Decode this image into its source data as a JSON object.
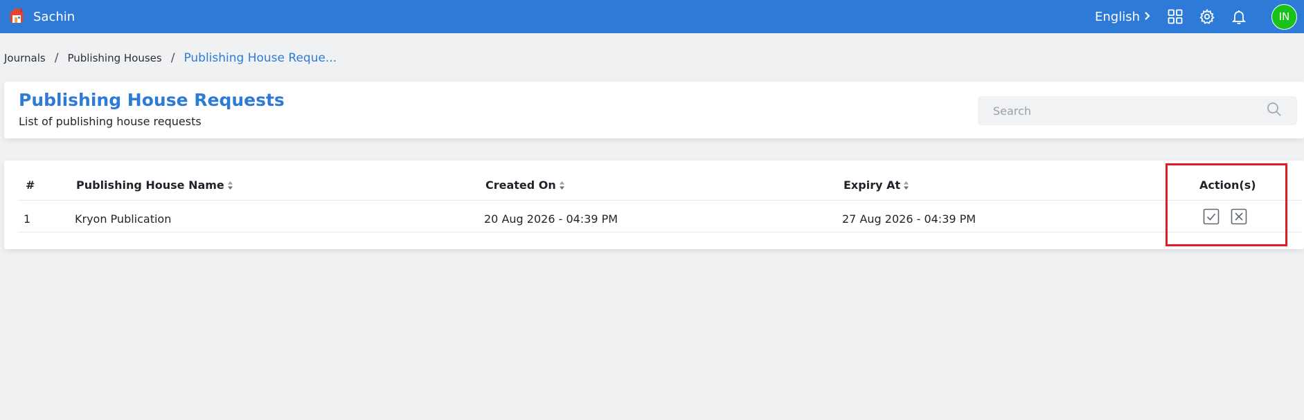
{
  "topbar": {
    "app_name": "Sachin",
    "language": "English",
    "avatar_initials": "IN",
    "bg_color": "#2d7bd6",
    "icons": [
      "home-icon",
      "apps-grid-icon",
      "gear-icon",
      "bell-icon"
    ]
  },
  "breadcrumb": {
    "items": [
      "Journals",
      "Publishing Houses"
    ],
    "current": "Publishing House Reque..."
  },
  "header": {
    "title": "Publishing House Requests",
    "subtitle": "List of publishing house requests",
    "search_placeholder": "Search"
  },
  "table": {
    "columns": [
      "#",
      "Publishing House Name",
      "Created On",
      "Expiry At",
      "Action(s)"
    ],
    "rows": [
      {
        "index": "1",
        "name": "Kryon Publication",
        "created_on": "20 Aug 2026 - 04:39 PM",
        "expiry_at": "27 Aug 2026 - 04:39 PM",
        "actions": [
          "approve-check-icon",
          "reject-x-icon"
        ]
      }
    ]
  },
  "colors": {
    "accent": "#2d7bd6",
    "avatar": "#19c21a",
    "highlight": "#e41b23"
  }
}
